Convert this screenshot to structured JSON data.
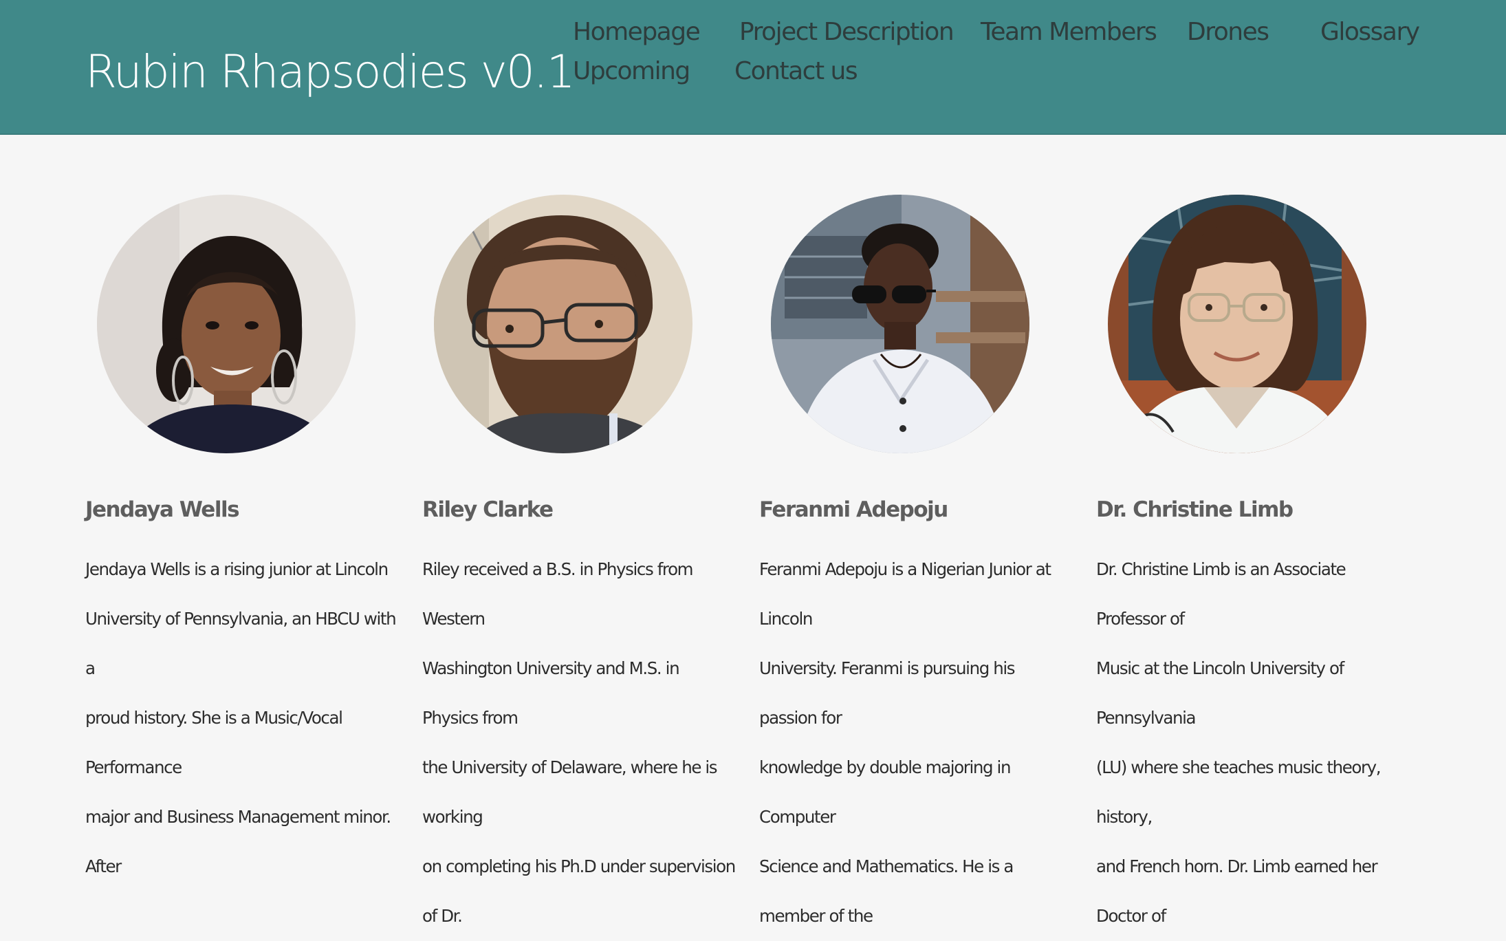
{
  "header": {
    "site_title": "Rubin Rhapsodies v0.1",
    "background_color": "#408989"
  },
  "nav": {
    "items": [
      {
        "label": "Homepage"
      },
      {
        "label": "Project Description"
      },
      {
        "label": "Team Members"
      },
      {
        "label": "Drones"
      },
      {
        "label": "Glossary"
      },
      {
        "label": "Upcoming"
      },
      {
        "label": "Contact us"
      }
    ]
  },
  "members": [
    {
      "name": "Jendaya Wells",
      "bio_lines": [
        "Jendaya Wells is a rising junior at Lincoln",
        "University of Pennsylvania, an HBCU with a",
        "proud history. She is a Music/Vocal Performance",
        "major and Business Management minor. After"
      ]
    },
    {
      "name": "Riley Clarke",
      "bio_lines": [
        "Riley received a B.S. in Physics from Western",
        "Washington University and M.S. in Physics from",
        "the University of Delaware, where he is working",
        "on completing his Ph.D under supervision of Dr."
      ]
    },
    {
      "name": "Feranmi Adepoju",
      "bio_lines": [
        "Feranmi Adepoju is a Nigerian Junior at Lincoln",
        "University. Feranmi is pursuing his passion for",
        "knowledge by double majoring in Computer",
        "Science and Mathematics. He is a member of the"
      ]
    },
    {
      "name": "Dr. Christine Limb",
      "bio_lines": [
        "Dr. Christine Limb is an Associate Professor of",
        "Music at the Lincoln University of Pennsylvania",
        "(LU) where she teaches music theory, history,",
        "and French horn. Dr. Limb earned her Doctor of"
      ]
    }
  ]
}
